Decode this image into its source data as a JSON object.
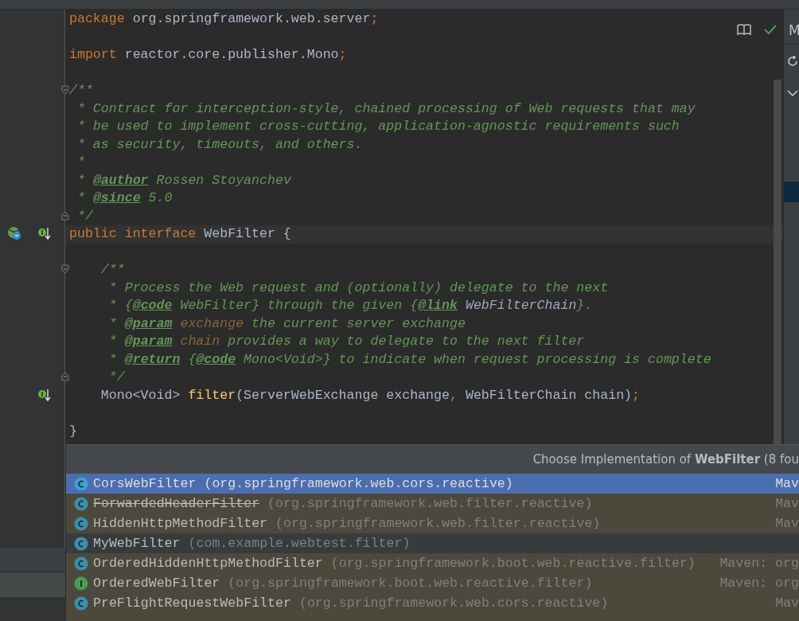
{
  "editor": {
    "lines": [
      {
        "tokens": [
          {
            "text": "package",
            "kind": "keyword"
          },
          {
            "text": " org.springframework.web.server",
            "kind": "plain"
          },
          {
            "text": ";",
            "kind": "keyword"
          }
        ]
      },
      {
        "kind": "blank"
      },
      {
        "tokens": [
          {
            "text": "import",
            "kind": "keyword"
          },
          {
            "text": " reactor.core.publisher.Mono",
            "kind": "plain"
          },
          {
            "text": ";",
            "kind": "keyword"
          }
        ]
      },
      {
        "kind": "blank"
      },
      {
        "kind": "fold-start",
        "tokens": [
          {
            "text": "/**",
            "kind": "doc"
          }
        ]
      },
      {
        "tokens": [
          {
            "text": " * Contract for interception-style, chained processing of Web requests that may",
            "kind": "doc"
          }
        ]
      },
      {
        "tokens": [
          {
            "text": " * be used to implement cross-cutting, application-agnostic requirements such",
            "kind": "doc"
          }
        ]
      },
      {
        "tokens": [
          {
            "text": " * as security, timeouts, and others.",
            "kind": "doc"
          }
        ]
      },
      {
        "tokens": [
          {
            "text": " *",
            "kind": "doc"
          }
        ]
      },
      {
        "tokens": [
          {
            "text": " * ",
            "kind": "doc"
          },
          {
            "text": "@author",
            "kind": "doctag"
          },
          {
            "text": " Rossen Stoyanchev",
            "kind": "doc"
          }
        ]
      },
      {
        "tokens": [
          {
            "text": " * ",
            "kind": "doc"
          },
          {
            "text": "@since",
            "kind": "doctag"
          },
          {
            "text": " 5.0",
            "kind": "doc"
          }
        ]
      },
      {
        "kind": "fold-end",
        "tokens": [
          {
            "text": " */",
            "kind": "doc"
          }
        ]
      },
      {
        "current": true,
        "markers": [
          {
            "kind": "bean"
          },
          {
            "kind": "implemented"
          }
        ],
        "tokens": [
          {
            "text": "public interface",
            "kind": "keyword"
          },
          {
            "text": " WebFilter {",
            "kind": "plain"
          }
        ]
      },
      {
        "kind": "blank"
      },
      {
        "kind": "fold-start",
        "tokens": [
          {
            "text": "    /**",
            "kind": "doc"
          }
        ]
      },
      {
        "tokens": [
          {
            "text": "     * Process the Web request and (optionally) delegate to the next",
            "kind": "doc"
          }
        ]
      },
      {
        "tokens": [
          {
            "text": "     * {",
            "kind": "doc"
          },
          {
            "text": "@code",
            "kind": "doctag"
          },
          {
            "text": " WebFilter} through the given {",
            "kind": "doc"
          },
          {
            "text": "@link",
            "kind": "doctag"
          },
          {
            "text": " WebFilterChain",
            "kind": "doclink"
          },
          {
            "text": "}.",
            "kind": "doc"
          }
        ]
      },
      {
        "tokens": [
          {
            "text": "     * ",
            "kind": "doc"
          },
          {
            "text": "@param",
            "kind": "doctag"
          },
          {
            "text": " exchange",
            "kind": "docparam"
          },
          {
            "text": " the current server exchange",
            "kind": "doc"
          }
        ]
      },
      {
        "tokens": [
          {
            "text": "     * ",
            "kind": "doc"
          },
          {
            "text": "@param",
            "kind": "doctag"
          },
          {
            "text": " chain",
            "kind": "docparam"
          },
          {
            "text": " provides a way to delegate to the next filter",
            "kind": "doc"
          }
        ]
      },
      {
        "tokens": [
          {
            "text": "     * ",
            "kind": "doc"
          },
          {
            "text": "@return",
            "kind": "doctag"
          },
          {
            "text": " {",
            "kind": "doc"
          },
          {
            "text": "@code",
            "kind": "doctag"
          },
          {
            "text": " Mono<Void>} to indicate when request processing is complete",
            "kind": "doc"
          }
        ]
      },
      {
        "kind": "fold-end",
        "tokens": [
          {
            "text": "     */",
            "kind": "doc"
          }
        ]
      },
      {
        "markers": [
          {
            "kind": "implemented"
          }
        ],
        "tokens": [
          {
            "text": "    Mono<Void> ",
            "kind": "plain"
          },
          {
            "text": "filter",
            "kind": "method"
          },
          {
            "text": "(ServerWebExchange exchange",
            "kind": "plain"
          },
          {
            "text": ",",
            "kind": "keyword"
          },
          {
            "text": " WebFilterChain chain)",
            "kind": "plain"
          },
          {
            "text": ";",
            "kind": "keyword"
          }
        ]
      },
      {
        "kind": "blank"
      },
      {
        "tokens": [
          {
            "text": "}",
            "kind": "plain"
          }
        ]
      }
    ]
  },
  "right_panel": {
    "title": "M"
  },
  "popup": {
    "title": "Choose Implementation of **WebFilter** (8 fou",
    "items": [
      {
        "name": "CorsWebFilter",
        "package": "(org.springframework.web.cors.reactive)",
        "location": "Mav",
        "kind": "class",
        "in_project": false,
        "deprecated": false,
        "selected": true
      },
      {
        "name": "ForwardedHeaderFilter",
        "package": "(org.springframework.web.filter.reactive)",
        "location": "Mav",
        "kind": "class",
        "in_project": false,
        "deprecated": true,
        "selected": false
      },
      {
        "name": "HiddenHttpMethodFilter",
        "package": "(org.springframework.web.filter.reactive)",
        "location": "Mav",
        "kind": "class",
        "in_project": false,
        "deprecated": false,
        "selected": false
      },
      {
        "name": "MyWebFilter",
        "package": "(com.example.webtest.filter)",
        "kind": "class",
        "in_project": true,
        "deprecated": false,
        "selected": false
      },
      {
        "name": "OrderedHiddenHttpMethodFilter",
        "package": "(org.springframework.boot.web.reactive.filter)",
        "location": "Maven: org",
        "kind": "class",
        "in_project": false,
        "deprecated": false,
        "selected": false
      },
      {
        "name": "OrderedWebFilter",
        "package": "(org.springframework.boot.web.reactive.filter)",
        "location": "Maven: org",
        "kind": "interface",
        "in_project": false,
        "deprecated": false,
        "selected": false
      },
      {
        "name": "PreFlightRequestWebFilter",
        "package": "(org.springframework.web.cors.reactive)",
        "location": "Mav",
        "kind": "class",
        "in_project": false,
        "deprecated": false,
        "selected": false
      }
    ]
  }
}
